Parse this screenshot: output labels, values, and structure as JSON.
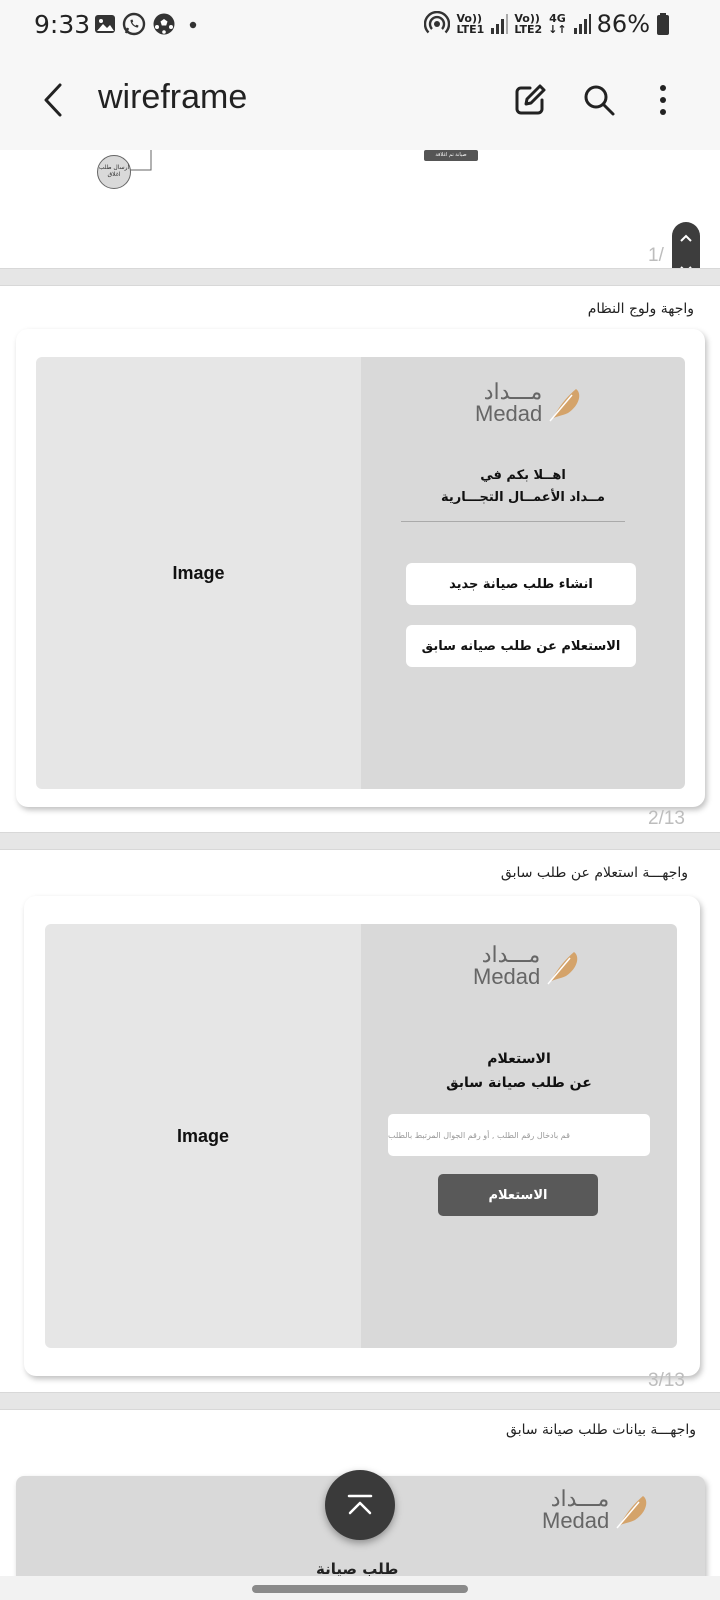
{
  "status_bar": {
    "time": "9:33",
    "sim1_top": "Vo))",
    "sim1_bottom": "LTE1",
    "sim2_top": "Vo))",
    "sim2_bottom": "LTE2",
    "network": "4G",
    "battery": "86%",
    "icons": [
      "gallery-icon",
      "whatsapp-icon",
      "soccer-icon",
      "dot-icon",
      "hotspot-icon",
      "signal-icon",
      "battery-icon"
    ]
  },
  "app_bar": {
    "title": "wireframe",
    "icons": [
      "back-icon",
      "edit-icon",
      "search-icon",
      "more-icon"
    ]
  },
  "page1": {
    "flow_node_label": "ارسال طلب اغلاق",
    "flow_tag_label": "صيانة تم اغلاقة",
    "counter": "1/"
  },
  "page2": {
    "heading": "واجهة ولوج النظام",
    "image_label": "Image",
    "logo_ar": "مـــداد",
    "logo_en": "Medad",
    "welcome_line1": "اهــلا بكم في",
    "welcome_line2": "مــداد الأعمــال التجـــارية",
    "new_request_button": "انشاء طلب صيانة جديد",
    "inquiry_button": "الاستعلام عن طلب صيانه سابق",
    "counter": "2/13"
  },
  "page3": {
    "heading": "واجهـــة  استعلام عن  طلب سابق",
    "image_label": "Image",
    "logo_ar": "مـــداد",
    "logo_en": "Medad",
    "title_line1": "الاستعلام",
    "title_line2": "عن طلب صيانة سابق",
    "input_placeholder": "قم بادخال رقم الطلب , أو رقم الجوال المرتبط بالطلب",
    "submit_button": "الاستعلام",
    "counter": "3/13"
  },
  "page4": {
    "heading": "واجهـــة  بيانات طلب صيانة سابق",
    "logo_ar": "مـــداد",
    "logo_en": "Medad",
    "title": "طلب صيانة"
  },
  "colors": {
    "panel_gray": "#d9d9d9",
    "image_gray": "#e6e6e6",
    "dark_button": "#595959",
    "logo_gold": "#c9955a"
  }
}
